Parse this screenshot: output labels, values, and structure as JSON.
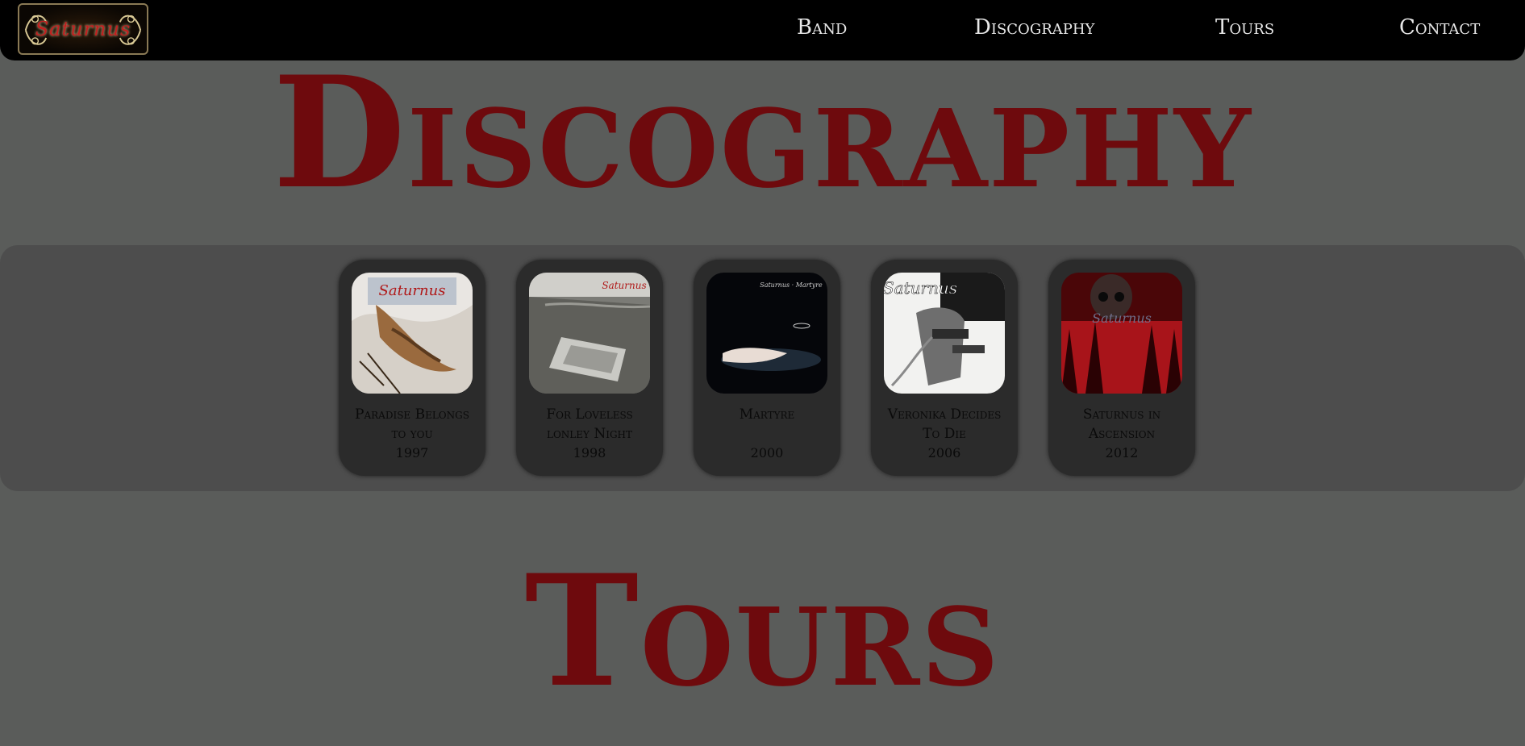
{
  "header": {
    "logo_text": "Saturnus",
    "nav": [
      "Band",
      "Discography",
      "Tours",
      "Contact"
    ]
  },
  "sections": {
    "discography_title": "Discography",
    "tours_title": "Tours"
  },
  "albums": [
    {
      "title_line1": "Paradise Belongs",
      "title_line2": "to you",
      "year": "1997",
      "cover_text": "Saturnus"
    },
    {
      "title_line1": "For Loveless",
      "title_line2": "lonley Night",
      "year": "1998",
      "cover_text": "Saturnus"
    },
    {
      "title_line1": "Martyre",
      "title_line2": "",
      "year": "2000",
      "cover_text": "Saturnus · Martyre"
    },
    {
      "title_line1": "Veronika Decides",
      "title_line2": "To Die",
      "year": "2006",
      "cover_text": "Saturnus"
    },
    {
      "title_line1": "Saturnus in",
      "title_line2": "Ascension",
      "year": "2012",
      "cover_text": "Saturnus"
    }
  ],
  "colors": {
    "background": "#5a5c5a",
    "topbar": "#000000",
    "heading": "#6e0a0d",
    "album_card": "#2b2b2b",
    "album_band": "#4d4d4d"
  }
}
